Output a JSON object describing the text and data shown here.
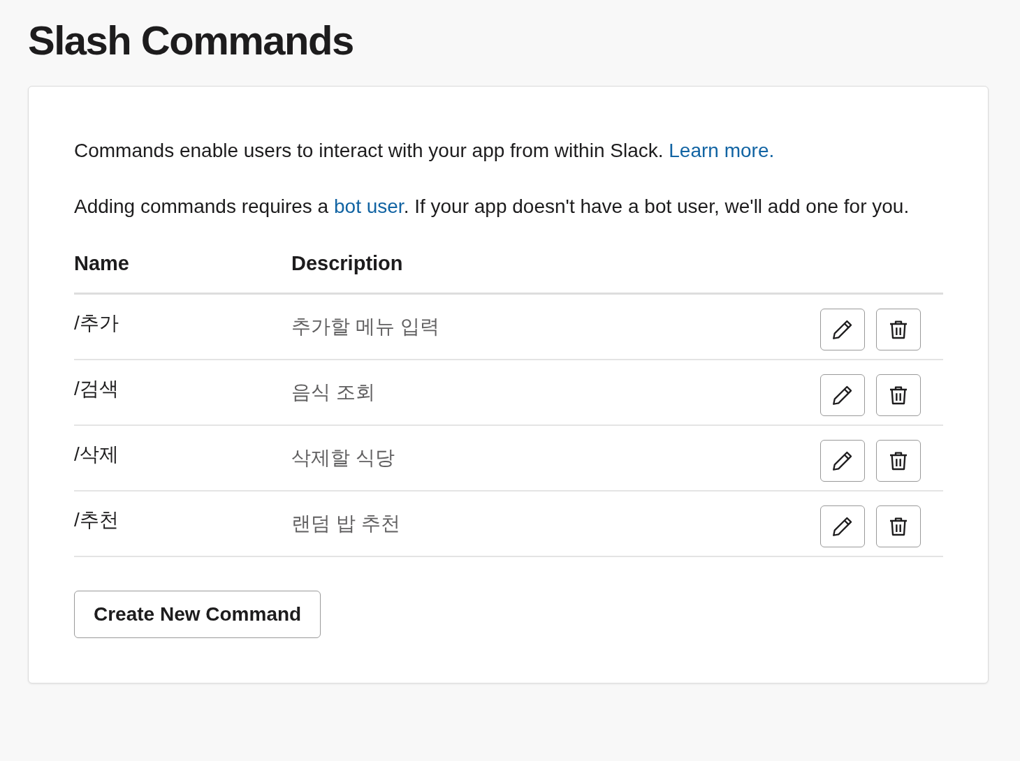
{
  "title": "Slash Commands",
  "paragraphs": [
    {
      "parts": [
        {
          "kind": "text",
          "text": "Commands enable users to interact with your app from within Slack. "
        },
        {
          "kind": "link",
          "text": "Learn more."
        }
      ]
    },
    {
      "parts": [
        {
          "kind": "text",
          "text": "Adding commands requires a "
        },
        {
          "kind": "link",
          "text": "bot user"
        },
        {
          "kind": "text",
          "text": ". If your app doesn't have a bot user, we'll add one for you."
        }
      ]
    }
  ],
  "table": {
    "columns": [
      "Name",
      "Description"
    ],
    "rows": [
      {
        "name": "/추가",
        "description": "추가할 메뉴 입력"
      },
      {
        "name": "/검색",
        "description": "음식 조회"
      },
      {
        "name": "/삭제",
        "description": "삭제할 식당"
      },
      {
        "name": "/추천",
        "description": "랜덤 밥 추천"
      }
    ]
  },
  "create_button": "Create New Command"
}
